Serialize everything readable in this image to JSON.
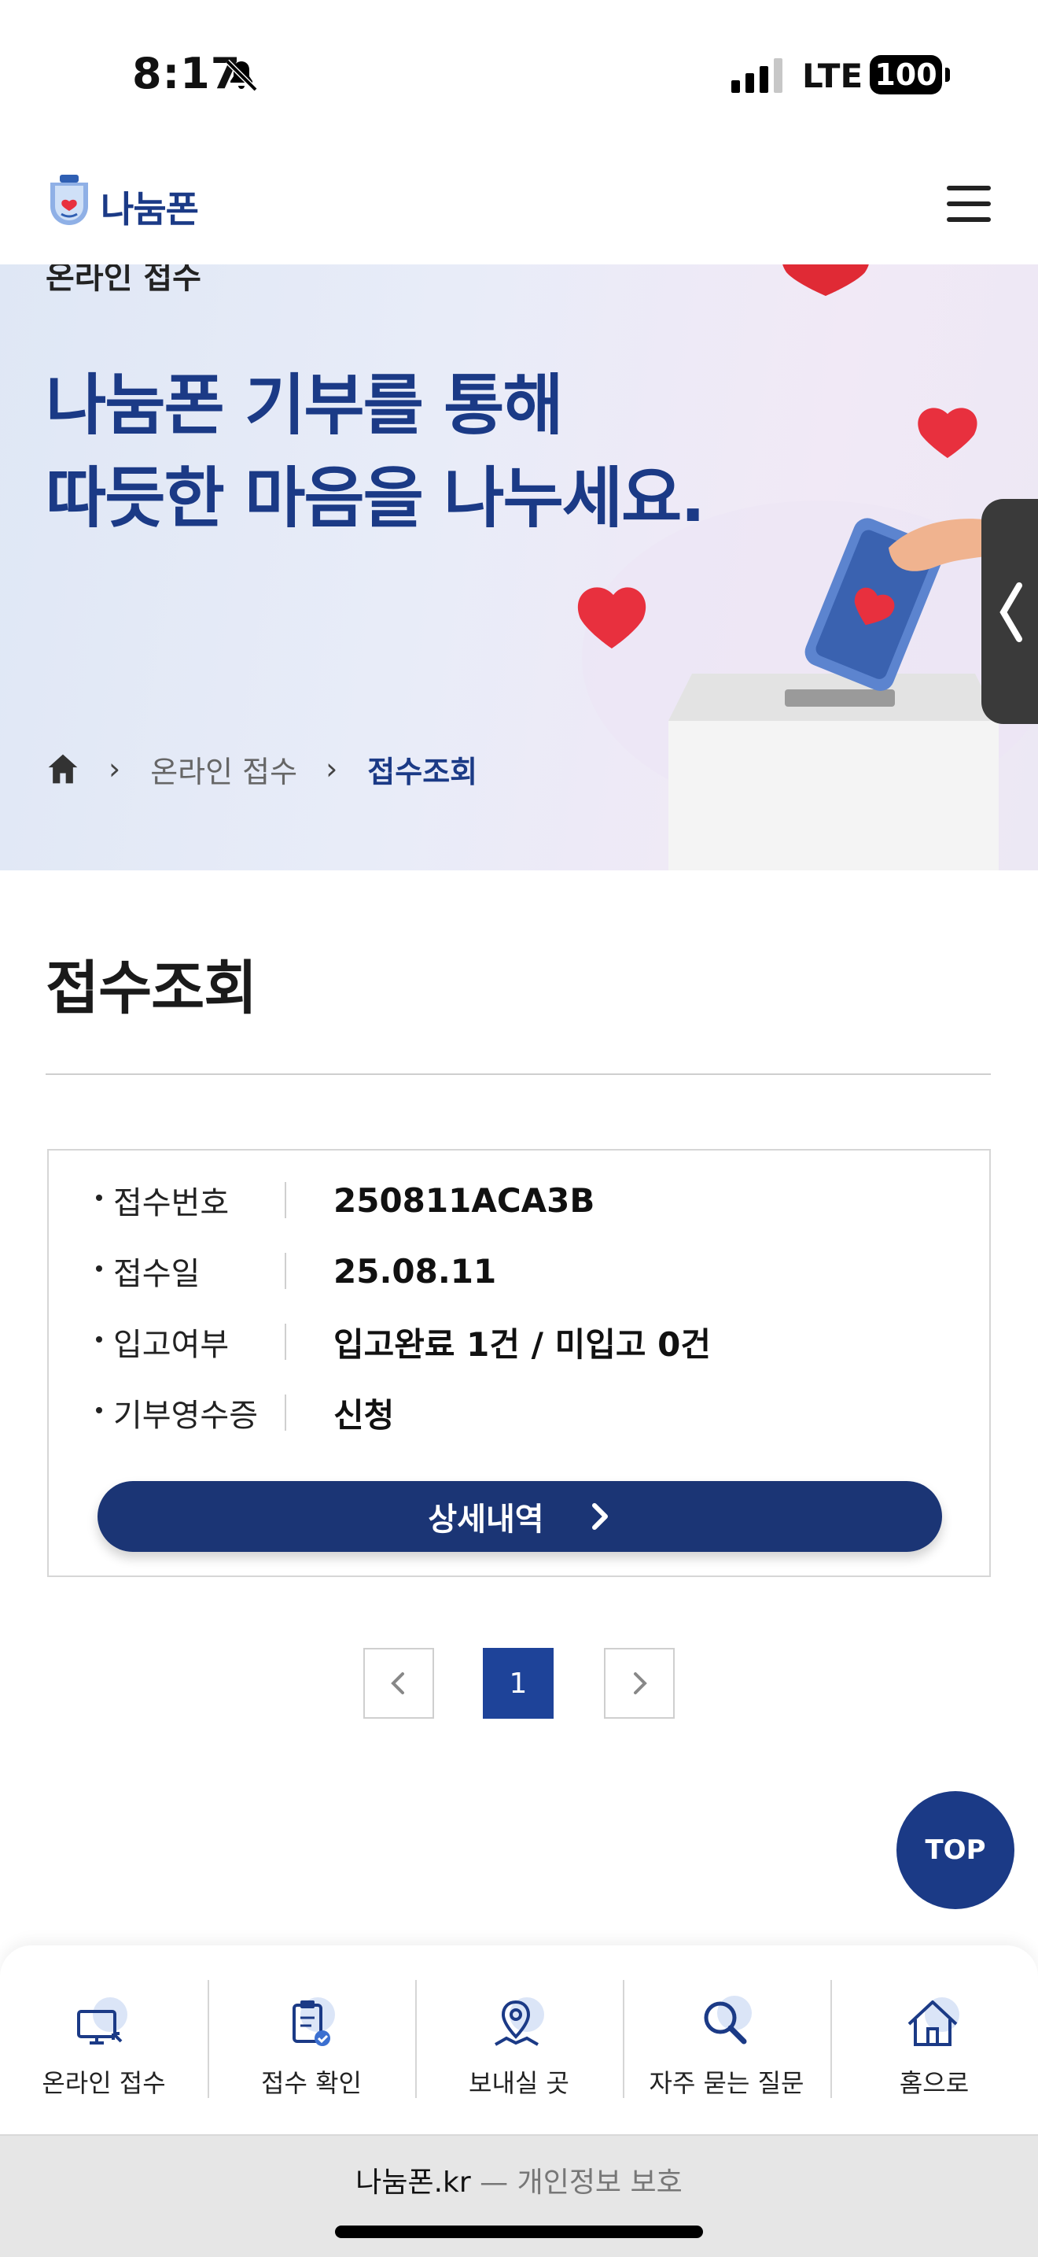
{
  "status_bar": {
    "time": "8:17",
    "network": "LTE",
    "battery": "100"
  },
  "header": {
    "logo_text": "나눔폰"
  },
  "hero": {
    "cut_text": "온라인 접수",
    "title_line1": "나눔폰 기부를 통해",
    "title_line2": "따듯한 마음을 나누세요.",
    "breadcrumb": [
      "온라인 접수",
      "접수조회"
    ]
  },
  "page_title": "접수조회",
  "receipt": {
    "rows": [
      {
        "label": "접수번호",
        "value": "250811ACA3B"
      },
      {
        "label": "접수일",
        "value": "25.08.11"
      },
      {
        "label": "입고여부",
        "value": "입고완료 1건 / 미입고 0건"
      },
      {
        "label": "기부영수증",
        "value": "신청"
      }
    ],
    "detail_button": "상세내역"
  },
  "pagination": {
    "current": "1"
  },
  "top_button": "TOP",
  "bottom_nav": [
    {
      "label": "온라인 접수",
      "icon": "monitor-icon"
    },
    {
      "label": "접수 확인",
      "icon": "clipboard-check-icon"
    },
    {
      "label": "보내실 곳",
      "icon": "map-pin-icon"
    },
    {
      "label": "자주 묻는 질문",
      "icon": "search-icon"
    },
    {
      "label": "홈으로",
      "icon": "home-icon"
    }
  ],
  "browser": {
    "url_main": "나눔폰.kr",
    "url_sub": " — 개인정보 보호"
  },
  "colors": {
    "brand": "#1b3a86",
    "button": "#1b3575",
    "page_active": "#1e4399",
    "heart": "#e8303e"
  }
}
